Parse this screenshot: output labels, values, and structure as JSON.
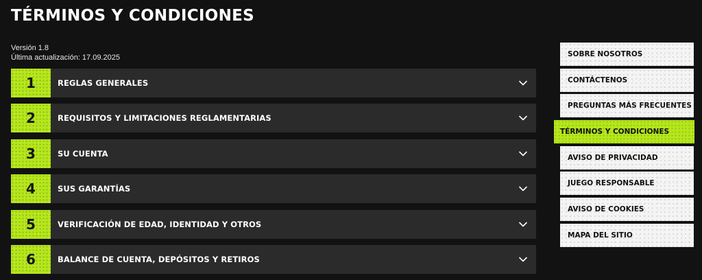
{
  "page": {
    "title": "TÉRMINOS Y CONDICIONES",
    "version": "Versión 1.8",
    "last_update": "Última actualización: 17.09.2025"
  },
  "accordion": {
    "items": [
      {
        "number": "1",
        "label": "REGLAS GENERALES"
      },
      {
        "number": "2",
        "label": "REQUISITOS Y LIMITACIONES REGLAMENTARIAS"
      },
      {
        "number": "3",
        "label": "SU CUENTA"
      },
      {
        "number": "4",
        "label": "SUS GARANTÍAS"
      },
      {
        "number": "5",
        "label": "VERIFICACIÓN DE EDAD, IDENTIDAD Y OTROS"
      },
      {
        "number": "6",
        "label": "BALANCE DE CUENTA, DEPÓSITOS Y RETIROS"
      }
    ],
    "chevron_icon": "chevron-down-icon"
  },
  "side_nav": {
    "items": [
      {
        "label": "SOBRE NOSOTROS",
        "active": false
      },
      {
        "label": "CONTÁCTENOS",
        "active": false
      },
      {
        "label": "PREGUNTAS MÁS FRECUENTES",
        "active": false
      },
      {
        "label": "TÉRMINOS Y CONDICIONES",
        "active": true
      },
      {
        "label": "AVISO DE PRIVACIDAD",
        "active": false
      },
      {
        "label": "JUEGO RESPONSABLE",
        "active": false
      },
      {
        "label": "AVISO DE COOKIES",
        "active": false
      },
      {
        "label": "MAPA DEL SITIO",
        "active": false
      }
    ]
  },
  "colors": {
    "background": "#121212",
    "accent": "#b4e61a",
    "row_background": "#2b2b2b",
    "nav_background": "#f4f4f4"
  }
}
